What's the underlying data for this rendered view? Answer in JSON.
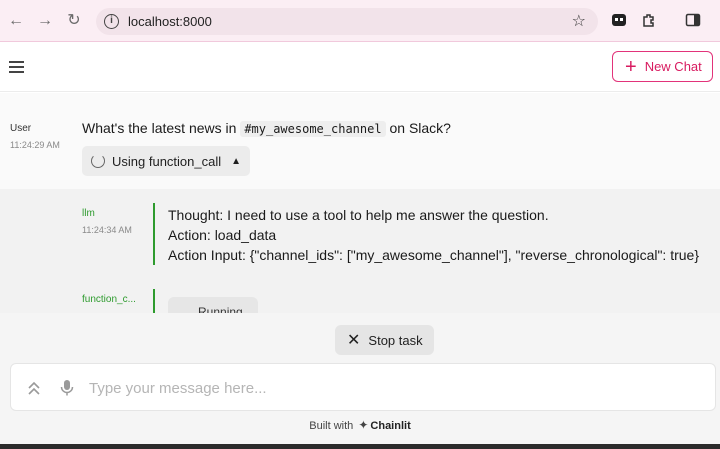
{
  "browser": {
    "url": "localhost:8000"
  },
  "header": {
    "new_chat_label": "New Chat",
    "accent_color": "#d81b60"
  },
  "messages": [
    {
      "author": "User",
      "time": "11:24:29 AM",
      "text_before": "What's the latest news in ",
      "code": "#my_awesome_channel",
      "text_after": " on Slack?",
      "step_label": "Using function_call"
    },
    {
      "author": "llm",
      "time": "11:24:34 AM",
      "lines": [
        "Thought: I need to use a tool to help me answer the question.",
        "Action: load_data",
        "Action Input: {\"channel_ids\": [\"my_awesome_channel\"], \"reverse_chronological\": true}"
      ]
    },
    {
      "author": "function_c...",
      "status": "Running"
    }
  ],
  "footer": {
    "stop_label": "Stop task",
    "input_placeholder": "Type your message here...",
    "built_with": "Built with",
    "brand": "Chainlit"
  },
  "colors": {
    "step_line": "#2e9b2e"
  }
}
